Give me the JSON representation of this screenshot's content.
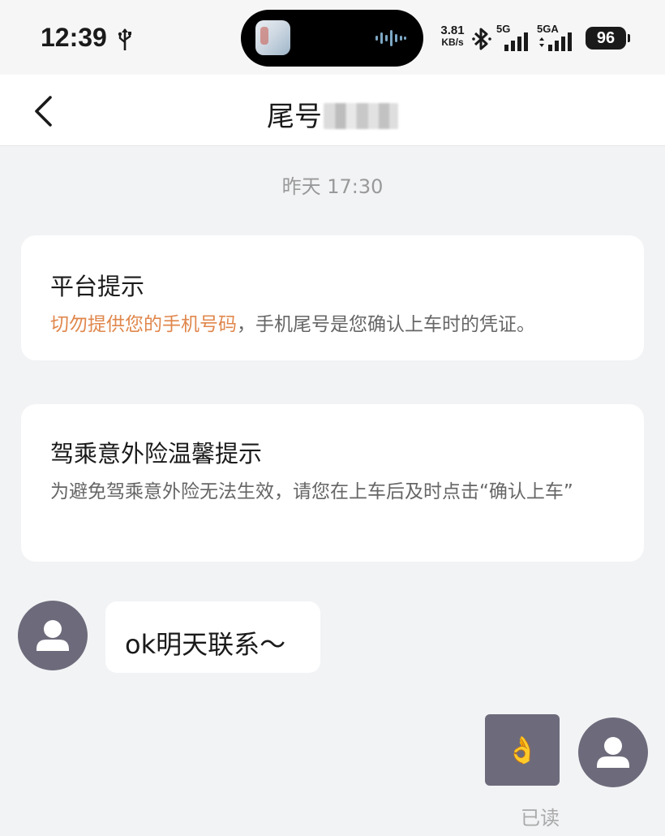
{
  "status_bar": {
    "time": "12:39",
    "net_speed_value": "3.81",
    "net_speed_unit": "KB/s",
    "signal_1_label": "5G",
    "signal_2_label": "5GA",
    "battery": "96",
    "icons": [
      "usb-icon",
      "music-app-icon",
      "audio-wave-icon",
      "bluetooth-icon",
      "signal-icon",
      "battery-icon"
    ]
  },
  "header": {
    "title": "尾号",
    "back_icon": "chevron-left-icon"
  },
  "chat": {
    "timestamp": "昨天 17:30",
    "platform_notice": {
      "title": "平台提示",
      "body_highlight": "切勿提供您的手机号码",
      "body_rest": "，手机尾号是您确认上车时的凭证。"
    },
    "insurance_notice": {
      "title": "驾乘意外险温馨提示",
      "body": "为避免驾乘意外险无法生效，请您在上车后及时点击“确认上车”"
    },
    "incoming_message": "ok明天联系～",
    "outgoing_message": "👌",
    "read_status": "已读"
  },
  "colors": {
    "accent": "#e0874c",
    "background": "#f2f3f5",
    "avatar": "#6d6b7b"
  }
}
